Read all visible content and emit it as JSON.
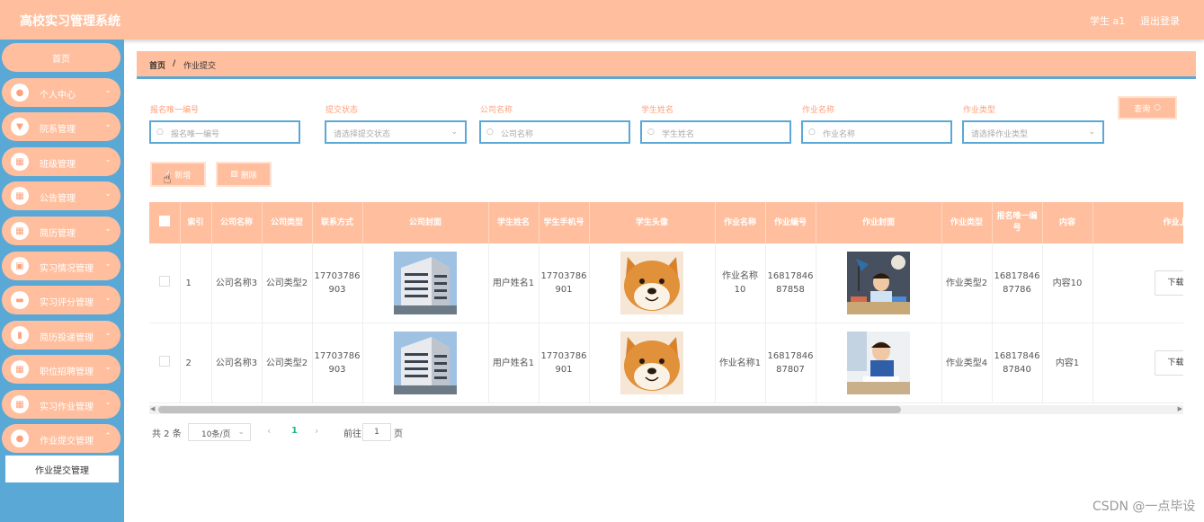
{
  "header": {
    "app_title": "高校实习管理系统",
    "user": "学生 a1",
    "logout": "退出登录"
  },
  "sidebar": {
    "home": "首页",
    "items": [
      {
        "label": "个人中心",
        "icon": "person-icon"
      },
      {
        "label": "院系管理",
        "icon": "funnel-icon"
      },
      {
        "label": "班级管理",
        "icon": "grid-icon"
      },
      {
        "label": "公告管理",
        "icon": "grid-icon"
      },
      {
        "label": "简历管理",
        "icon": "grid-icon"
      },
      {
        "label": "实习情况管理",
        "icon": "clipboard-icon"
      },
      {
        "label": "实习评分管理",
        "icon": "briefcase-icon"
      },
      {
        "label": "简历投递管理",
        "icon": "chart-icon"
      },
      {
        "label": "职位招聘管理",
        "icon": "grid-icon"
      },
      {
        "label": "实习作业管理",
        "icon": "grid-icon"
      },
      {
        "label": "作业提交管理",
        "icon": "person-icon"
      }
    ],
    "active_sub": "作业提交管理"
  },
  "breadcrumb": {
    "home": "首页",
    "sep": "/",
    "current": "作业提交"
  },
  "search": {
    "fields": [
      {
        "label": "报名唯一编号",
        "placeholder": "报名唯一编号",
        "type": "input"
      },
      {
        "label": "提交状态",
        "placeholder": "请选择提交状态",
        "type": "select"
      },
      {
        "label": "公司名称",
        "placeholder": "公司名称",
        "type": "input"
      },
      {
        "label": "学生姓名",
        "placeholder": "学生姓名",
        "type": "input"
      },
      {
        "label": "作业名称",
        "placeholder": "作业名称",
        "type": "input"
      },
      {
        "label": "作业类型",
        "placeholder": "请选择作业类型",
        "type": "select"
      }
    ],
    "query_button": "查询"
  },
  "actions": {
    "add": "新增",
    "delete": "删除"
  },
  "table": {
    "columns": [
      "索引",
      "公司名称",
      "公司类型",
      "联系方式",
      "公司封面",
      "学生姓名",
      "学生手机号",
      "学生头像",
      "作业名称",
      "作业编号",
      "作业封面",
      "作业类型",
      "报名唯一编号",
      "内容",
      "作业上传"
    ],
    "rows": [
      {
        "index": "1",
        "company": "公司名称3",
        "company_type": "公司类型2",
        "contact": "17703786903",
        "student": "用户姓名1",
        "phone": "17703786901",
        "hw_name": "作业名称10",
        "hw_no": "1681784687858",
        "hw_cover": "study-lamp",
        "hw_type": "作业类型2",
        "reg_no": "1681784687786",
        "content": "内容10",
        "upload": "下载"
      },
      {
        "index": "2",
        "company": "公司名称3",
        "company_type": "公司类型2",
        "contact": "17703786903",
        "student": "用户姓名1",
        "phone": "17703786901",
        "hw_name": "作业名称1",
        "hw_no": "1681784687807",
        "hw_cover": "study-kid",
        "hw_type": "作业类型4",
        "reg_no": "1681784687840",
        "content": "内容1",
        "upload": "下载"
      }
    ]
  },
  "pagination": {
    "total": "共 2 条",
    "page_size": "10条/页",
    "current": "1",
    "goto": "前往",
    "goto_value": "1",
    "page_suffix": "页"
  },
  "watermark": "CSDN @一点毕设",
  "colors": {
    "accent": "#ffbf9e",
    "sidebar": "#5aa8d6",
    "label": "#ffa07a",
    "page_active": "#26b58a"
  }
}
